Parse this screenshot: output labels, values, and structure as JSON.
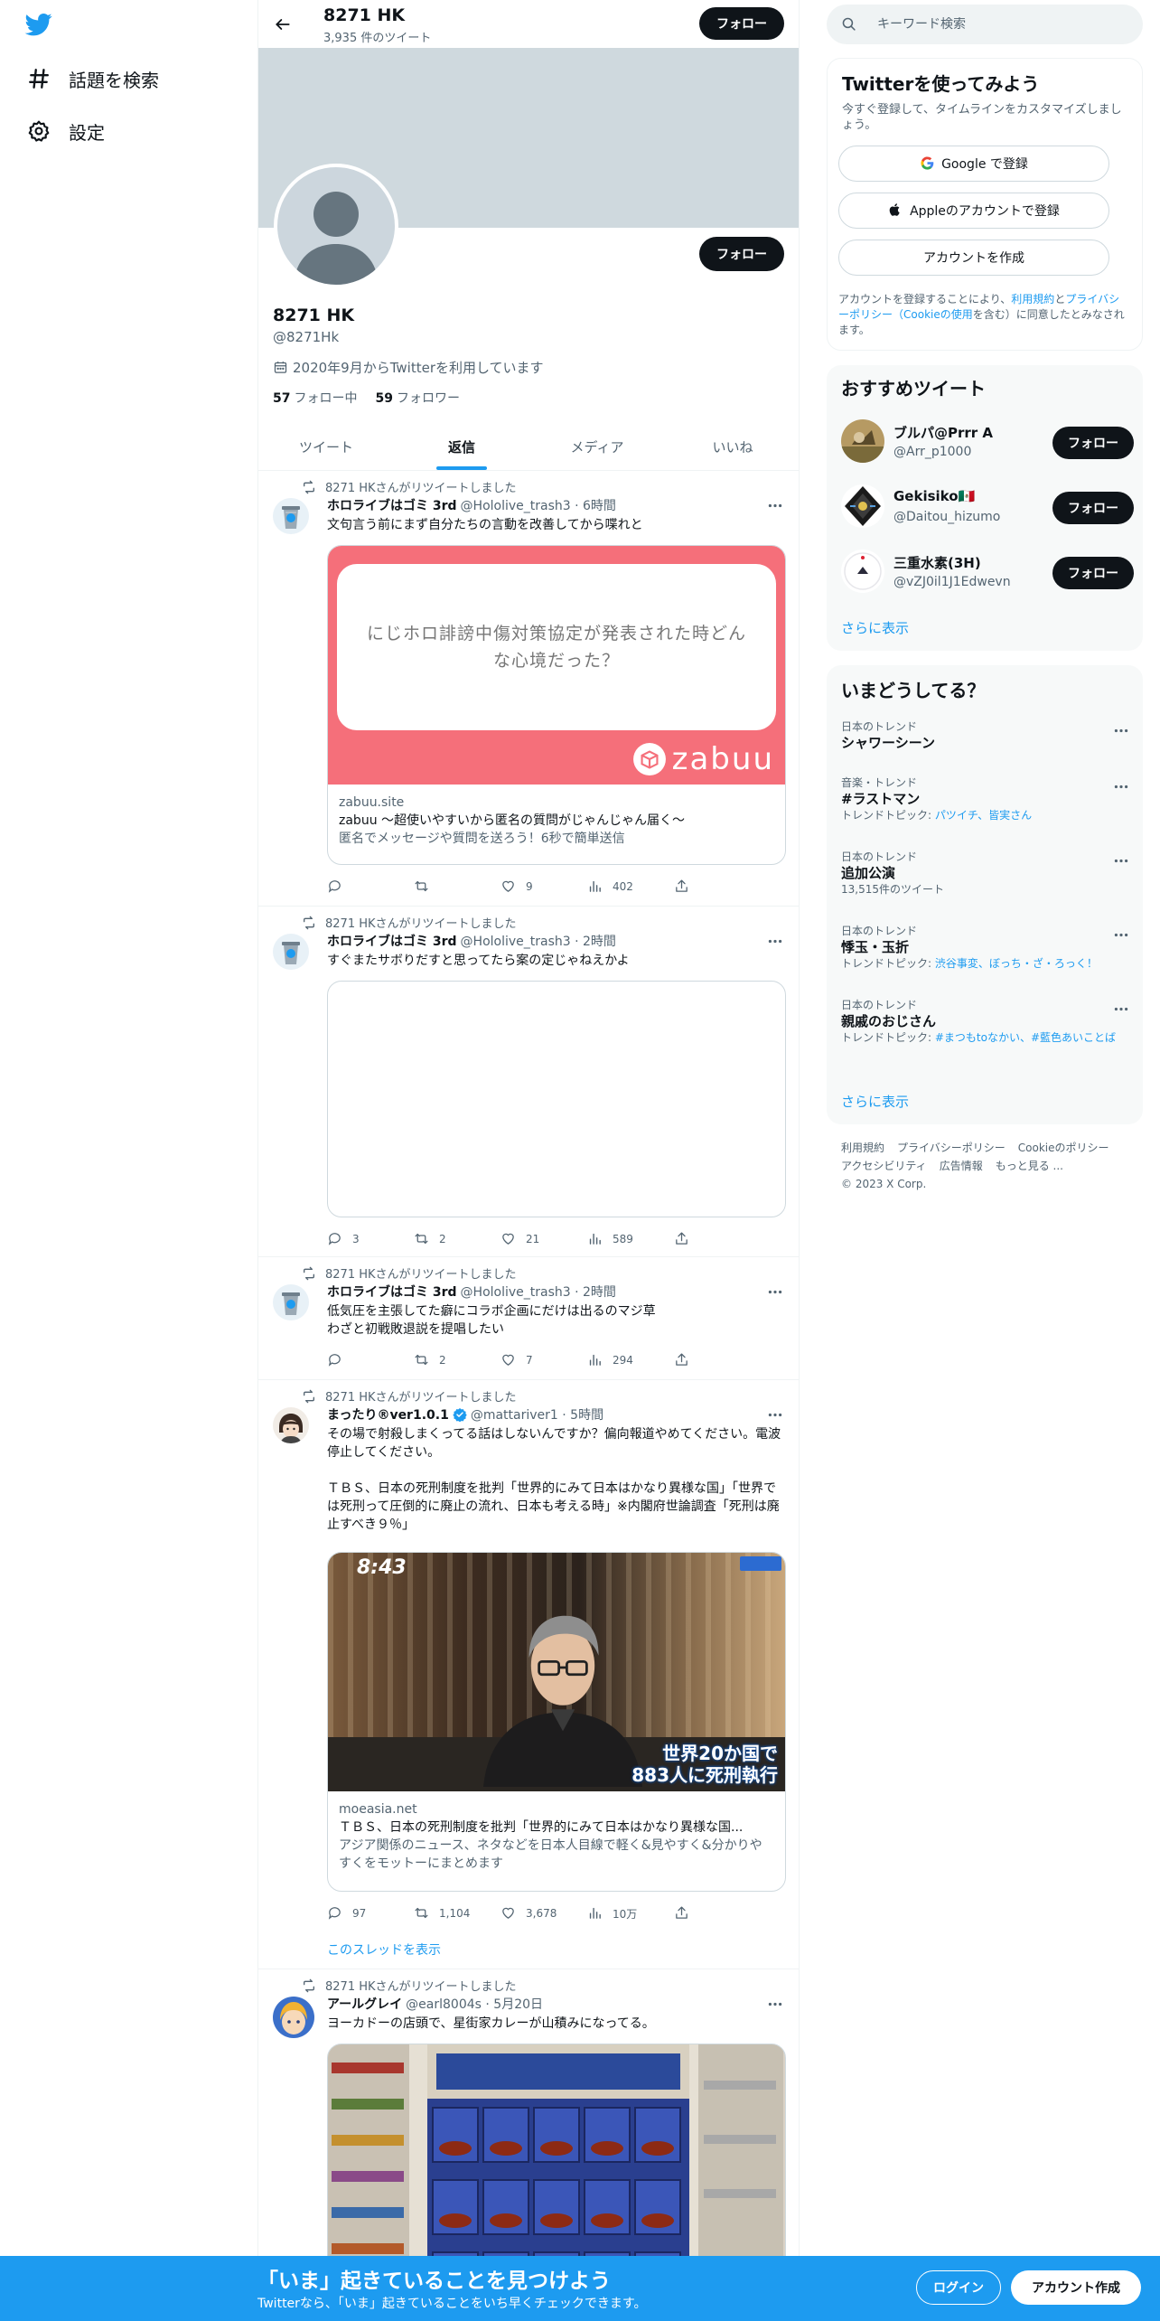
{
  "leftnav": {
    "items": [
      {
        "label": "話題を検索",
        "icon": "hashtag-icon"
      },
      {
        "label": "設定",
        "icon": "gear-icon"
      }
    ]
  },
  "header": {
    "name": "8271 HK",
    "tweet_count": "3,935 件のツイート",
    "follow_label": "フォロー"
  },
  "profile": {
    "name": "8271 HK",
    "handle": "@8271Hk",
    "joined": "2020年9月からTwitterを利用しています",
    "following_count": "57",
    "following_label": "フォロー中",
    "followers_count": "59",
    "followers_label": "フォロワー",
    "follow_label": "フォロー"
  },
  "tabs": [
    {
      "label": "ツイート",
      "active": false
    },
    {
      "label": "返信",
      "active": true
    },
    {
      "label": "メディア",
      "active": false
    },
    {
      "label": "いいね",
      "active": false
    }
  ],
  "tweets": [
    {
      "retweeted_by": "8271 HKさんがリツイートしました",
      "name": "ホロライブはゴミ 3rd",
      "handle": "@Hololive_trash3 · 6時間",
      "text": "文句言う前にまず自分たちの言動を改善してから喋れと",
      "card": {
        "image_text": "にじホロ誹謗中傷対策協定が発表された時どんな心境だった？",
        "brand": "zabuu",
        "domain": "zabuu.site",
        "title": "zabuu 〜超使いやすいから匿名の質問がじゃんじゃん届く〜",
        "desc": "匿名でメッセージや質問を送ろう！6秒で簡単送信"
      },
      "replies": "",
      "retweets": "",
      "likes": "9",
      "views": "402"
    },
    {
      "retweeted_by": "8271 HKさんがリツイートしました",
      "name": "ホロライブはゴミ 3rd",
      "handle": "@Hololive_trash3 · 2時間",
      "text": "すぐまたサボりだすと思ってたら案の定じゃねえかよ",
      "replies": "3",
      "retweets": "2",
      "likes": "21",
      "views": "589"
    },
    {
      "retweeted_by": "8271 HKさんがリツイートしました",
      "name": "ホロライブはゴミ 3rd",
      "handle": "@Hololive_trash3 · 2時間",
      "text_line1": "低気圧を主張してた癖にコラボ企画にだけは出るのマジ草",
      "text_line2": "わざと初戦敗退説を提唱したい",
      "replies": "",
      "retweets": "2",
      "likes": "7",
      "views": "294"
    },
    {
      "retweeted_by": "8271 HKさんがリツイートしました",
      "name": "まったり®ver1.0.1",
      "handle": "@mattariver1 · 5時間",
      "text_p1": "その場で射殺しまくってる話はしないんですか？偏向報道やめてください。電波停止してください。",
      "text_p2": "ＴＢＳ、日本の死刑制度を批判「世界的にみて日本はかなり異様な国」「世界では死刑って圧倒的に廃止の流れ、日本も考える時」※内閣府世論調査「死刑は廃止すべき９％」",
      "card": {
        "time": "8:43",
        "caption1": "世界20か国で",
        "caption2": "883人に死刑執行",
        "domain": "moeasia.net",
        "title": "ＴＢＳ、日本の死刑制度を批判「世界的にみて日本はかなり異様な国...",
        "desc": "アジア関係のニュース、ネタなどを日本人目線で軽く&見やすく&分かりやすくをモットーにまとめます"
      },
      "replies": "97",
      "retweets": "1,104",
      "likes": "3,678",
      "views": "10万",
      "thread_link": "このスレッドを表示"
    },
    {
      "retweeted_by": "8271 HKさんがリツイートしました",
      "name": "アールグレイ",
      "handle": "@earl8004s · 5月20日",
      "text": "ヨーカドーの店頭で、星街家カレーが山積みになってる。"
    }
  ],
  "search": {
    "placeholder": "キーワード検索"
  },
  "signup": {
    "title": "Twitterを使ってみよう",
    "subtitle": "今すぐ登録して、タイムラインをカスタマイズしましょう。",
    "google_label": "Google で登録",
    "apple_label": "Appleのアカウントで登録",
    "create_label": "アカウントを作成",
    "legal_pre": "アカウントを登録することにより、",
    "legal_terms": "利用規約",
    "legal_and": "と",
    "legal_privacy": "プライバシーポリシー（Cookieの使用",
    "legal_post": "を含む）に同意したとみなされます。"
  },
  "recommended": {
    "title": "おすすめツイート",
    "follow_label": "フォロー",
    "show_more": "さらに表示",
    "accounts": [
      {
        "name": "ブルパ@Prrr A",
        "handle": "@Arr_p1000"
      },
      {
        "name": "Gekisiko🇲🇽",
        "handle": "@Daitou_hizumo"
      },
      {
        "name": "三重水素(3H)",
        "handle": "@vZJ0il1J1Edwevn"
      }
    ]
  },
  "trends": {
    "title": "いまどうしてる？",
    "show_more": "さらに表示",
    "items": [
      {
        "context": "日本のトレンド",
        "name": "シャワーシーン"
      },
      {
        "context": "音楽・トレンド",
        "name": "#ラストマン",
        "extra_pre": "トレンドトピック: ",
        "extra_links": "パツイチ、皆実さん"
      },
      {
        "context": "日本のトレンド",
        "name": "追加公演",
        "extra_pre": "13,515件のツイート"
      },
      {
        "context": "日本のトレンド",
        "name": "悸玉・玉折",
        "extra_pre": "トレンドトピック: ",
        "extra_links": "渋谷事変、ぼっち・ざ・ろっく！"
      },
      {
        "context": "日本のトレンド",
        "name": "親戚のおじさん",
        "extra_pre": "トレンドトピック: ",
        "extra_links": "#まつもtoなかい、#藍色あいことば"
      }
    ]
  },
  "footer": {
    "links": [
      "利用規約",
      "プライバシーポリシー",
      "Cookieのポリシー",
      "アクセシビリティ",
      "広告情報",
      "もっと見る ...",
      "© 2023 X Corp."
    ]
  },
  "bottombar": {
    "title": "「いま」起きていることを見つけよう",
    "subtitle": "Twitterなら、「いま」起きていることをいち早くチェックできます。",
    "login_label": "ログイン",
    "signup_label": "アカウント作成"
  },
  "colors": {
    "accent": "#1d9bf0",
    "dark": "#0f1419",
    "muted": "#536471",
    "banner": "#cfd9de",
    "card_pink": "#f56f7a"
  }
}
